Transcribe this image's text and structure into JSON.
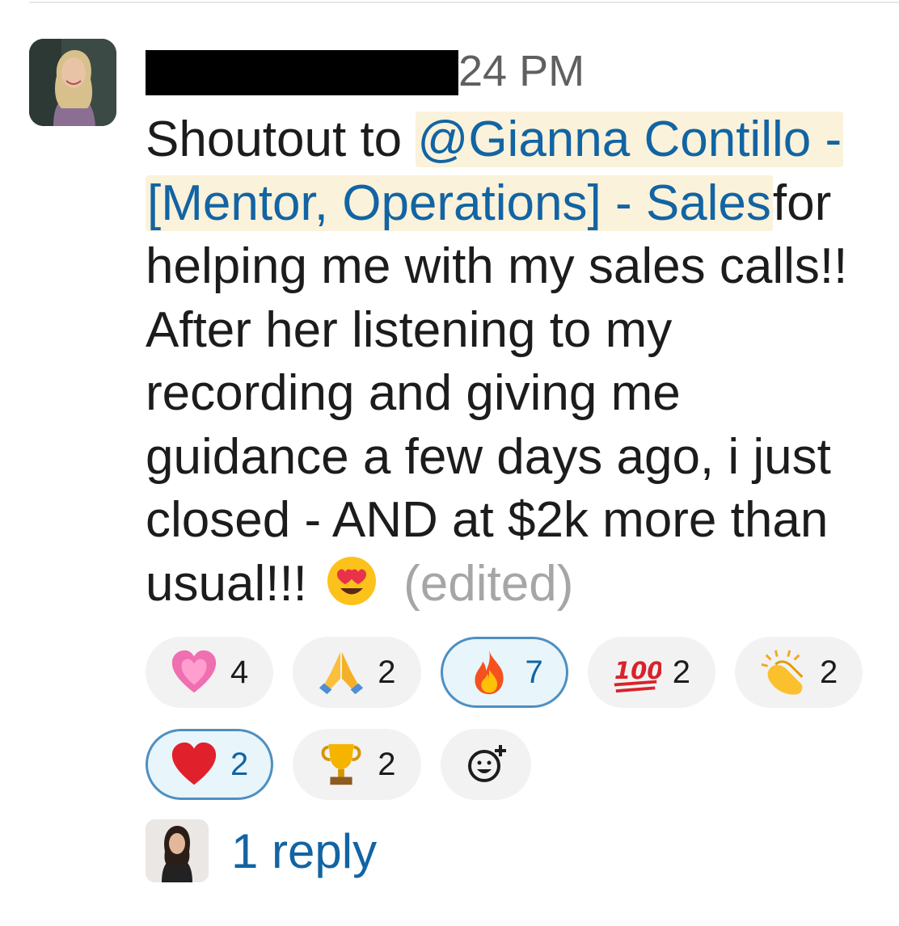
{
  "message": {
    "timestamp": "24 PM",
    "text_before": "Shoutout to ",
    "mention": "@Gianna Contillo - [Mentor, Operations] - Sales",
    "text_after": "for helping me with my sales calls!! After her listening to my recording and giving me guidance a few days ago, i just closed - AND at $2k more than usual!!!",
    "edited_label": "(edited)",
    "inline_emoji": "heart-eyes"
  },
  "reactions": [
    {
      "emoji": "sparkling-heart",
      "count": "4",
      "selected": false
    },
    {
      "emoji": "folded-hands",
      "count": "2",
      "selected": false
    },
    {
      "emoji": "fire",
      "count": "7",
      "selected": true
    },
    {
      "emoji": "hundred-points",
      "count": "2",
      "selected": false
    },
    {
      "emoji": "clapping-hands",
      "count": "2",
      "selected": false
    },
    {
      "emoji": "red-heart",
      "count": "2",
      "selected": true
    },
    {
      "emoji": "trophy",
      "count": "2",
      "selected": false
    }
  ],
  "add_reaction_icon": "add-reaction-icon",
  "thread": {
    "reply_label": "1 reply"
  },
  "colors": {
    "mention_text": "#1264a3",
    "mention_bg": "#faf2da",
    "selected_border": "#4e8fc1",
    "selected_bg": "#e8f5fa"
  }
}
